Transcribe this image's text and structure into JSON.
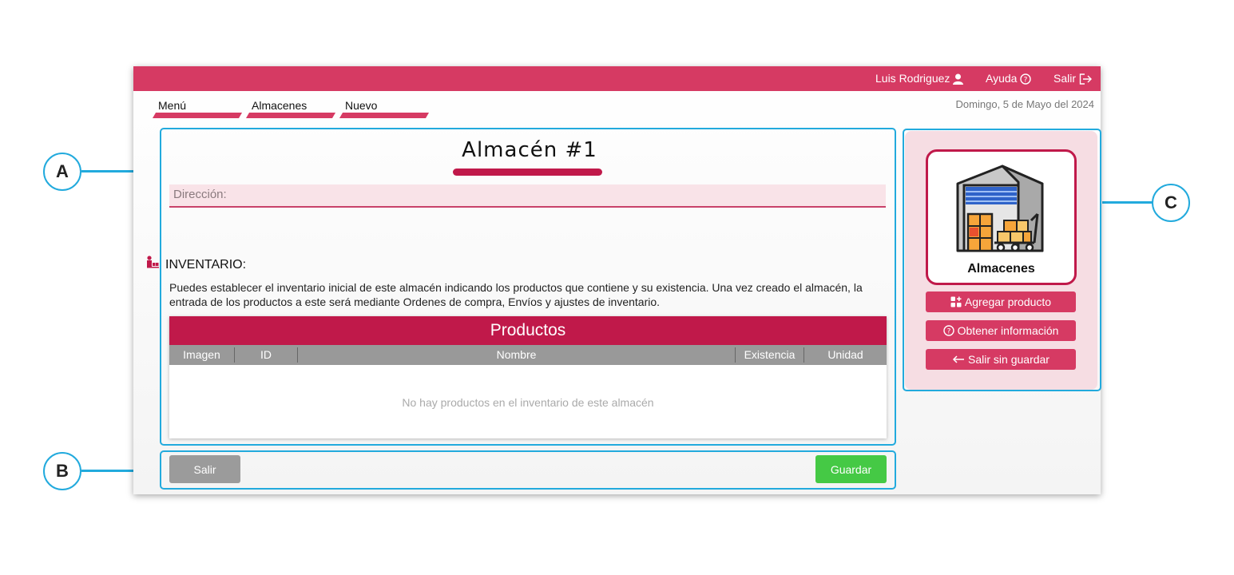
{
  "topbar": {
    "user": "Luis Rodriguez",
    "help": "Ayuda",
    "logout": "Salir",
    "color": "#d63a63"
  },
  "breadcrumb": [
    "Menú",
    "Almacenes",
    "Nuevo"
  ],
  "date": "Domingo, 5 de Mayo del 2024",
  "form": {
    "title": "Almacén #1",
    "address_placeholder": "Dirección:"
  },
  "inventory": {
    "title": "INVENTARIO:",
    "description": "Puedes establecer el inventario inicial de este almacén indicando los productos que contiene y su existencia. Una vez creado el almacén, la entrada de los productos a este será mediante Ordenes de compra, Envíos y ajustes de inventario.",
    "table_title": "Productos",
    "columns": [
      "Imagen",
      "ID",
      "Nombre",
      "Existencia",
      "Unidad"
    ],
    "empty_message": "No hay productos en el inventario de este almacén"
  },
  "footer": {
    "exit_label": "Salir",
    "save_label": "Guardar"
  },
  "sidepanel": {
    "card_label": "Almacenes",
    "card_icon": "warehouse-icon",
    "buttons": [
      "Agregar producto",
      "Obtener información",
      "Salir sin guardar"
    ]
  },
  "callouts": [
    "A",
    "B",
    "C"
  ],
  "colors": {
    "accent": "#d63a63",
    "accent_dark": "#c0194a",
    "save": "#45c945",
    "callout": "#22aadd"
  }
}
